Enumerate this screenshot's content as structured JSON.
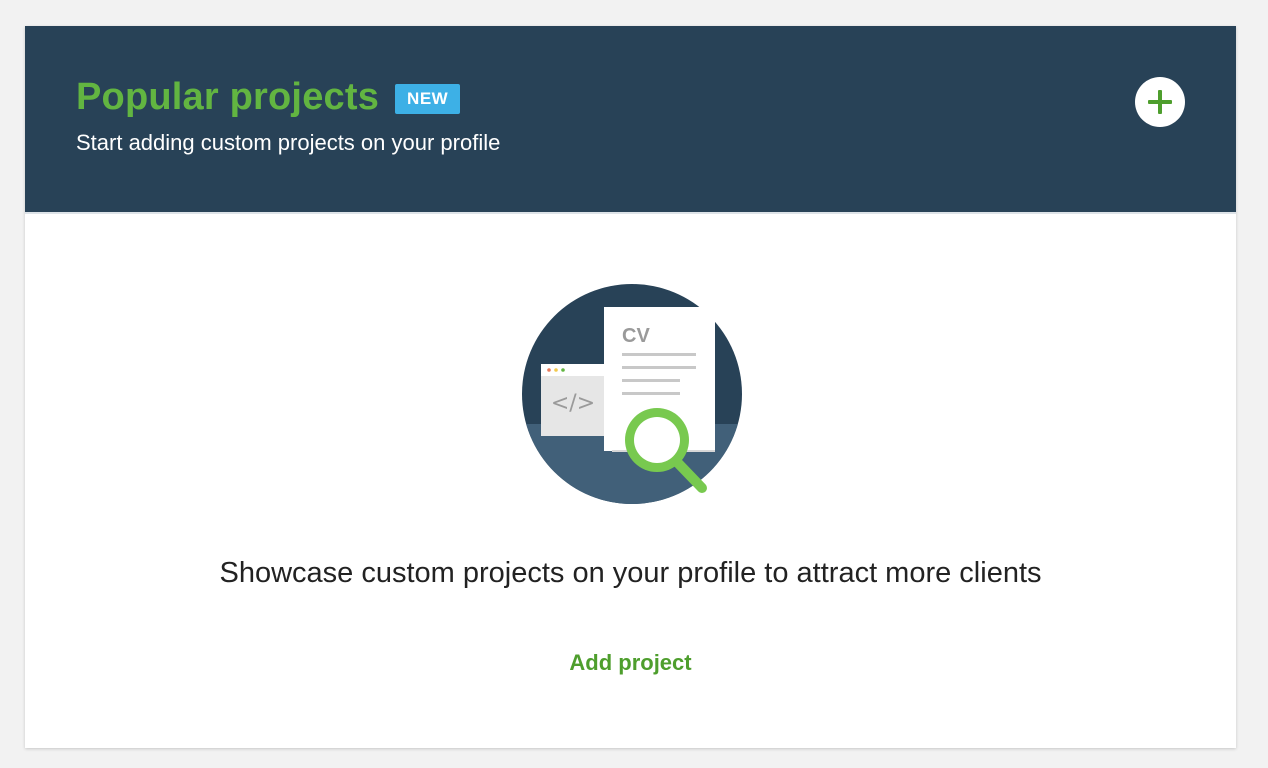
{
  "header": {
    "title": "Popular projects",
    "badge": "NEW",
    "subtitle": "Start adding custom projects on your profile",
    "add_icon": "plus-icon"
  },
  "illustration": {
    "doc_label": "CV",
    "code_glyph": "</>"
  },
  "main": {
    "message": "Showcase custom projects on your profile to attract more clients",
    "add_link": "Add project"
  },
  "colors": {
    "header_bg": "#284257",
    "title_green": "#62b541",
    "badge_blue": "#3db0e6",
    "link_green": "#4e9e2d"
  }
}
